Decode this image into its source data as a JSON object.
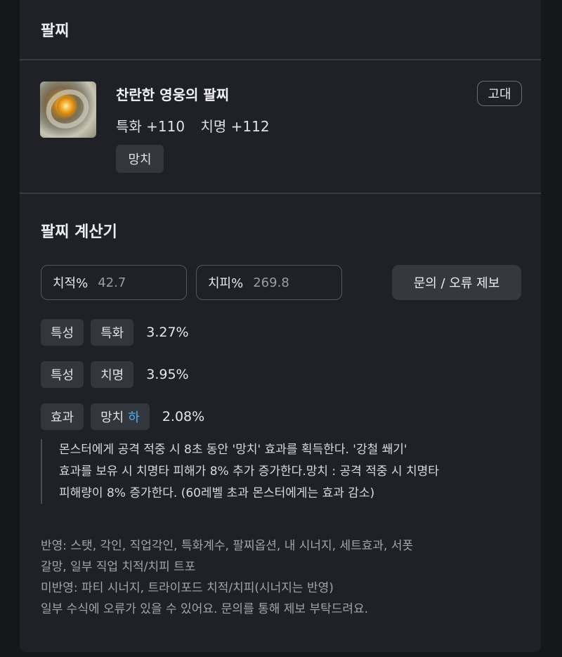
{
  "header": {
    "title": "팔찌"
  },
  "item": {
    "name": "찬란한 영웅의 팔찌",
    "grade": "고대",
    "stats": [
      {
        "label": "특화 +110"
      },
      {
        "label": "치명 +112"
      }
    ],
    "effect_tag": "망치",
    "icon": "bracelet-icon"
  },
  "calculator": {
    "title": "팔찌 계산기",
    "crit_rate": {
      "label": "치적%",
      "value": "42.7"
    },
    "crit_damage": {
      "label": "치피%",
      "value": "269.8"
    },
    "report_button": "문의 / 오류 제보",
    "rows": [
      {
        "category": "특성",
        "stat": "특화",
        "grade": "",
        "percent": "3.27%"
      },
      {
        "category": "특성",
        "stat": "치명",
        "grade": "",
        "percent": "3.95%"
      },
      {
        "category": "효과",
        "stat": "망치",
        "grade": "하",
        "percent": "2.08%"
      }
    ],
    "description": [
      "몬스터에게 공격 적중 시 8초 동안 '망치' 효과를 획득한다. '강철 쐐기'",
      "효과를 보유 시 치명타 피해가 8% 추가 증가한다.망치 : 공격 적중 시 치명타",
      "피해량이 8% 증가한다. (60레벨 초과 몬스터에게는 효과 감소)"
    ],
    "notes": [
      "반영: 스탯, 각인, 직업각인, 특화계수, 팔찌옵션, 내 시너지, 세트효과, 서폿",
      "갈망, 일부 직업 치적/치피 트포",
      "미반영: 파티 시너지, 트라이포드 치적/치피(시너지는 반영)",
      "일부 수식에 오류가 있을 수 있어요. 문의를 통해 제보 부탁드려요."
    ]
  },
  "colors": {
    "grade_low": "#5aa9ea",
    "panel_bg": "#202127",
    "page_bg": "#16171b"
  }
}
